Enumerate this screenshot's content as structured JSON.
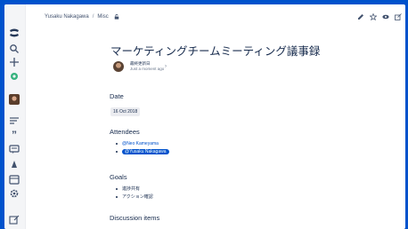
{
  "header": {
    "breadcrumb": [
      "Yusaku Nakagawa",
      "Misc"
    ],
    "breadcrumb_separator": "/"
  },
  "sidebar": {
    "icons": [
      "confluence-logo-icon",
      "search-icon",
      "create-plus-icon",
      "notifications-icon",
      "profile-avatar",
      "recent-pages-icon",
      "quotes-icon",
      "feedback-icon",
      "people-icon",
      "calendar-icon",
      "settings-icon",
      "expand-sidebar-icon"
    ]
  },
  "page": {
    "title": "マーケティングチームミーティング議事録",
    "byline": {
      "author": "最終更新日",
      "time": "Just a moment ago"
    },
    "sections": {
      "date": {
        "heading": "Date",
        "value": "16 Oct 2018"
      },
      "attendees": {
        "heading": "Attendees",
        "items": [
          "@Neo Kameyama",
          "@Yusaku Nakagawa"
        ]
      },
      "goals": {
        "heading": "Goals",
        "items": [
          "進捗共有",
          "アクション確認"
        ]
      },
      "discussion": {
        "heading": "Discussion items"
      }
    }
  },
  "colors": {
    "frame": "#0052cc",
    "sidebar": "#f4f5f7",
    "mention_self_bg": "#0052cc",
    "mention_text": "#0052cc",
    "lozenge_bg": "#ebecf0"
  }
}
